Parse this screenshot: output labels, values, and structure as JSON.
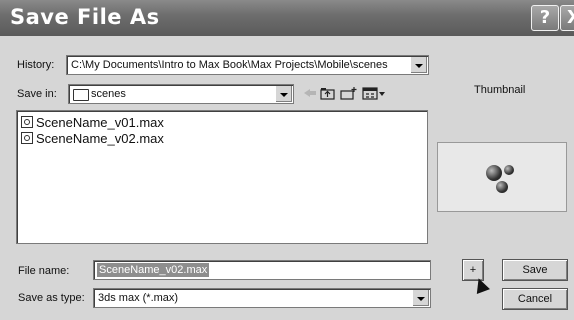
{
  "window": {
    "title": "Save File As",
    "help_label": "?",
    "close_label": "X"
  },
  "history": {
    "label": "History:",
    "value": "C:\\My Documents\\Intro to Max Book\\Max Projects\\Mobile\\scenes"
  },
  "save_in": {
    "label": "Save in:",
    "value": "scenes"
  },
  "toolbar": {
    "icons": [
      "back-icon",
      "up-folder-icon",
      "new-folder-icon",
      "view-menu-icon"
    ]
  },
  "files": [
    {
      "name": "SceneName_v01.max",
      "icon": "max-file-icon"
    },
    {
      "name": "SceneName_v02.max",
      "icon": "max-file-icon"
    }
  ],
  "thumbnail": {
    "label": "Thumbnail"
  },
  "file_name": {
    "label": "File name:",
    "value": "SceneName_v02.max"
  },
  "save_as_type": {
    "label": "Save as type:",
    "value": "3ds max (*.max)"
  },
  "buttons": {
    "plus_label": "+",
    "save_label": "Save",
    "cancel_label": "Cancel"
  }
}
